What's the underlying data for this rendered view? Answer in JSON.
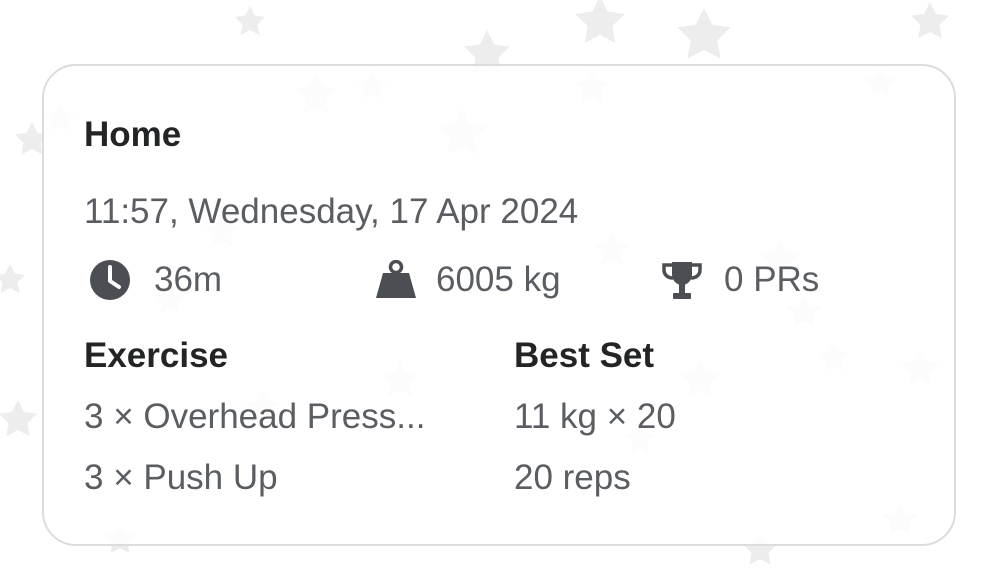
{
  "card": {
    "title": "Home",
    "datetime": "11:57, Wednesday, 17 Apr 2024",
    "stats": [
      {
        "icon": "clock-icon",
        "value": "36m"
      },
      {
        "icon": "weight-icon",
        "value": "6005 kg"
      },
      {
        "icon": "trophy-icon",
        "value": "0 PRs"
      }
    ],
    "table": {
      "headers": {
        "exercise": "Exercise",
        "best_set": "Best Set"
      },
      "rows": [
        {
          "exercise": "3 × Overhead Press...",
          "best_set": "11 kg × 20"
        },
        {
          "exercise": "3 × Push Up",
          "best_set": "20 reps"
        }
      ]
    }
  },
  "colors": {
    "title": "#222426",
    "secondary_text": "#5a5d61",
    "icon": "#4b4f54",
    "card_border": "#dcdcdc",
    "background_stars": "#ececec"
  }
}
